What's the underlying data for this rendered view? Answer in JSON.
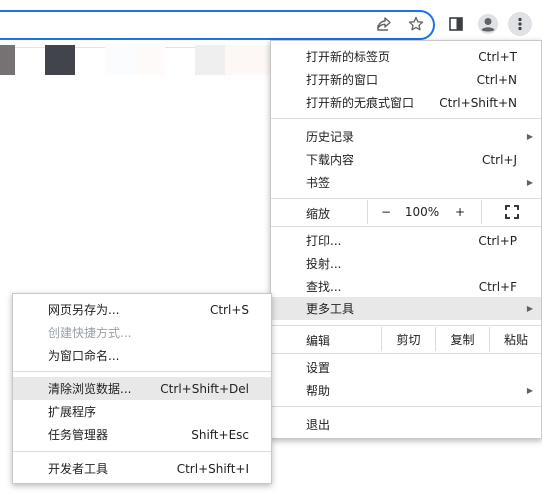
{
  "main_menu": {
    "new_tab": {
      "label": "打开新的标签页",
      "shortcut": "Ctrl+T"
    },
    "new_window": {
      "label": "打开新的窗口",
      "shortcut": "Ctrl+N"
    },
    "new_incognito": {
      "label": "打开新的无痕式窗口",
      "shortcut": "Ctrl+Shift+N"
    },
    "history": {
      "label": "历史记录"
    },
    "downloads": {
      "label": "下载内容",
      "shortcut": "Ctrl+J"
    },
    "bookmarks": {
      "label": "书签"
    },
    "zoom": {
      "label": "缩放",
      "minus": "−",
      "value": "100%",
      "plus": "+"
    },
    "print": {
      "label": "打印...",
      "shortcut": "Ctrl+P"
    },
    "cast": {
      "label": "投射..."
    },
    "find": {
      "label": "查找...",
      "shortcut": "Ctrl+F"
    },
    "more_tools": {
      "label": "更多工具"
    },
    "edit": {
      "label": "编辑",
      "cut": "剪切",
      "copy": "复制",
      "paste": "粘贴"
    },
    "settings": {
      "label": "设置"
    },
    "help": {
      "label": "帮助"
    },
    "exit": {
      "label": "退出"
    }
  },
  "sub_menu": {
    "save_page": {
      "label": "网页另存为...",
      "shortcut": "Ctrl+S"
    },
    "create_shortcut": {
      "label": "创建快捷方式..."
    },
    "name_window": {
      "label": "为窗口命名..."
    },
    "clear_data": {
      "label": "清除浏览数据...",
      "shortcut": "Ctrl+Shift+Del"
    },
    "extensions": {
      "label": "扩展程序"
    },
    "task_manager": {
      "label": "任务管理器",
      "shortcut": "Shift+Esc"
    },
    "dev_tools": {
      "label": "开发者工具",
      "shortcut": "Ctrl+Shift+I"
    }
  },
  "icons": {
    "share": "share-icon",
    "star": "star-icon",
    "side_panel": "side-panel-icon",
    "profile": "profile-icon",
    "more": "more-vert-icon",
    "fullscreen": "fullscreen-icon",
    "submenu_arrow": "chevron-right-icon"
  },
  "colors": {
    "omnibox_focus": "#1a73e8",
    "menu_hover": "#e8e8e8",
    "disabled_text": "#9aa0a6"
  }
}
